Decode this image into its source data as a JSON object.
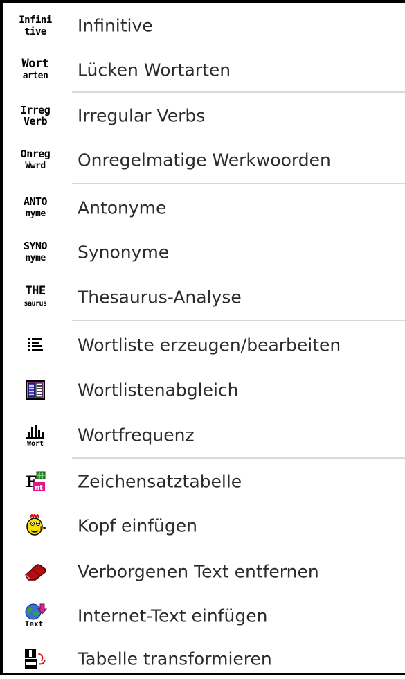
{
  "menu": {
    "items": [
      {
        "label": "Infinitive",
        "icon": "infinitive-icon",
        "icon_text": [
          "Infini",
          "tive"
        ]
      },
      {
        "label": "Lücken Wortarten",
        "icon": "wortarten-icon",
        "icon_text": [
          "Wort",
          "arten"
        ]
      },
      {
        "label": "Irregular Verbs",
        "icon": "irregular-verbs-icon",
        "icon_text": [
          "Irreg",
          "Verb"
        ]
      },
      {
        "label": "Onregelmatige Werkwoorden",
        "icon": "onregelmatige-icon",
        "icon_text": [
          "Onreg",
          "Wwrd"
        ]
      },
      {
        "label": "Antonyme",
        "icon": "antonyme-icon",
        "icon_text": [
          "ANTO",
          "nyme"
        ]
      },
      {
        "label": "Synonyme",
        "icon": "synonyme-icon",
        "icon_text": [
          "SYNO",
          "nyme"
        ]
      },
      {
        "label": "Thesaurus-Analyse",
        "icon": "thesaurus-icon",
        "icon_text": [
          "THE",
          "saurus"
        ]
      },
      {
        "label": "Wortliste erzeugen/bearbeiten",
        "icon": "wordlist-icon"
      },
      {
        "label": "Wortlistenabgleich",
        "icon": "wordlist-compare-icon"
      },
      {
        "label": "Wortfrequenz",
        "icon": "word-frequency-icon",
        "icon_text": [
          "",
          "Wort"
        ]
      },
      {
        "label": "Zeichensatztabelle",
        "icon": "charset-table-icon"
      },
      {
        "label": "Kopf einfügen",
        "icon": "insert-head-icon"
      },
      {
        "label": "Verborgenen Text entfernen",
        "icon": "eraser-icon"
      },
      {
        "label": "Internet-Text einfügen",
        "icon": "internet-text-icon",
        "icon_text": [
          "",
          "Text"
        ]
      },
      {
        "label": "Tabelle transformieren",
        "icon": "table-transform-icon"
      }
    ]
  }
}
